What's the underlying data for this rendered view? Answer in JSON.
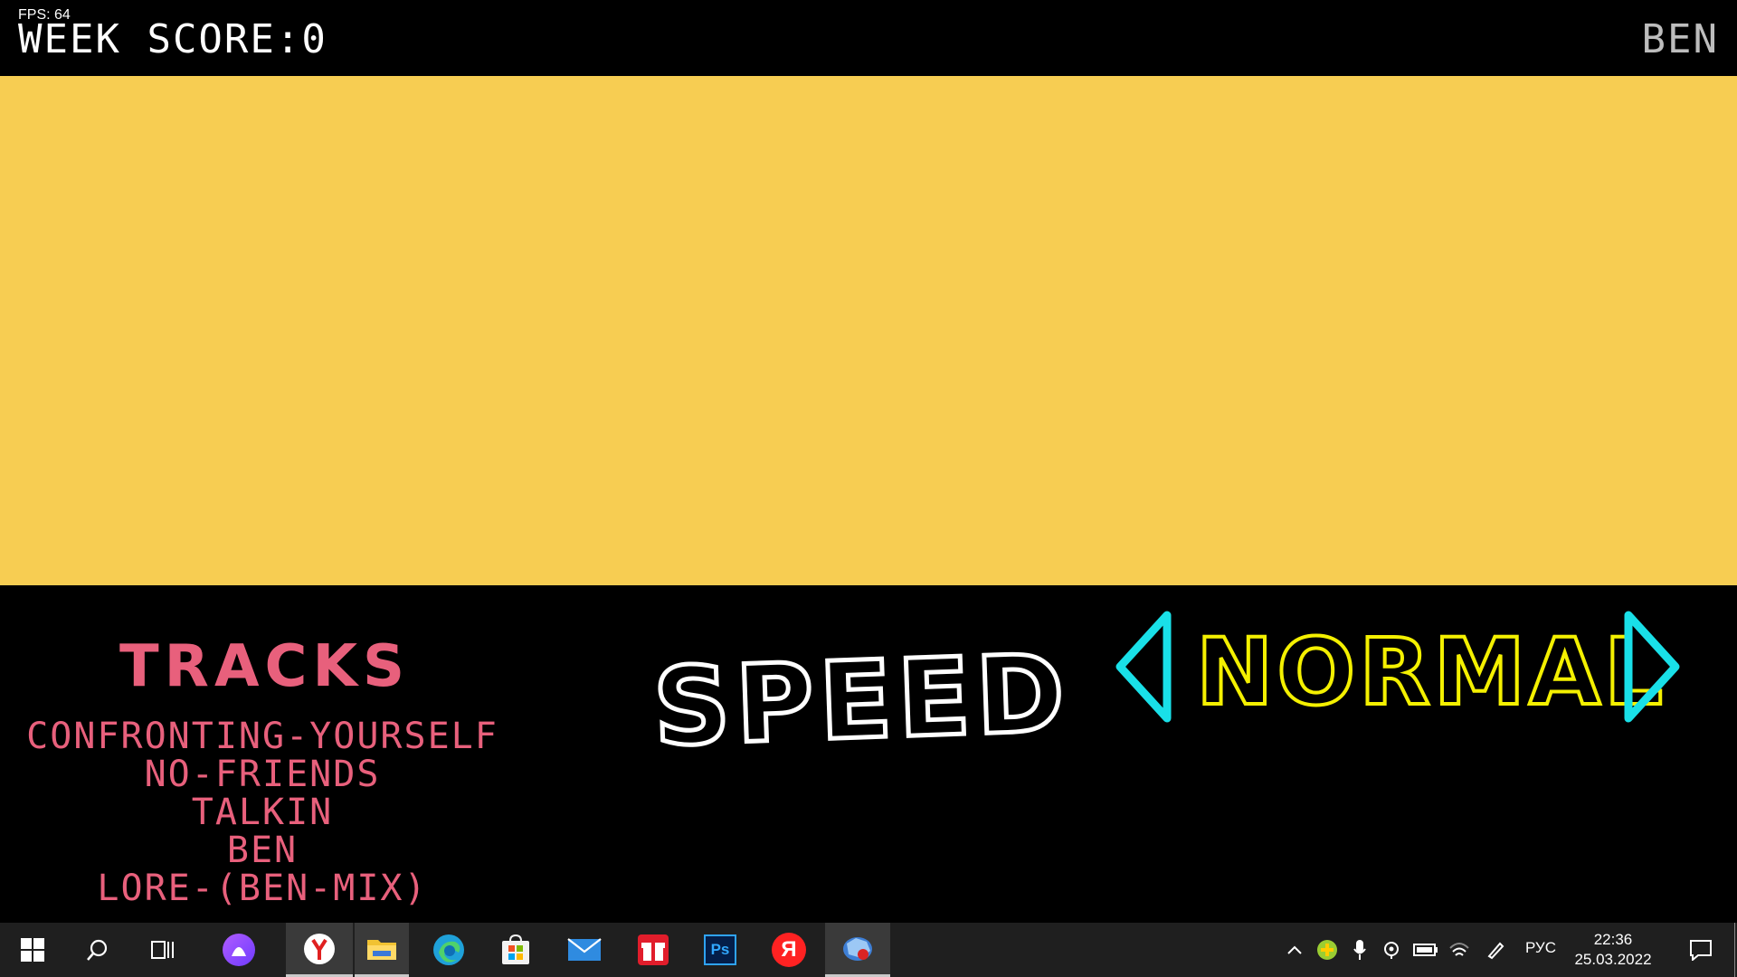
{
  "game": {
    "fps": "FPS: 64",
    "score": "WEEK SCORE:0",
    "week_name": "BEN",
    "banner_color": "#f7cd52",
    "tracks_title": "TRACKS",
    "tracks": [
      "CONFRONTING-YOURSELF",
      "NO-FRIENDS",
      "TALKIN",
      "BEN",
      "LORE-(BEN-MIX)"
    ],
    "speed_label": "SPEED",
    "difficulty": "NORMAL",
    "colors": {
      "tracks": "#e8607c",
      "difficulty": "#f4f000",
      "arrows": "#19e0e8"
    }
  },
  "taskbar": {
    "icons": [
      "windows-start-icon",
      "search-icon",
      "task-view-icon",
      "alice-icon",
      "yandex-browser-icon",
      "file-explorer-icon",
      "edge-icon",
      "store-icon",
      "mail-icon",
      "gift-icon",
      "photoshop-icon",
      "yandex-icon",
      "game-icon"
    ],
    "photoshop_text": "Ps",
    "yandex_text": "Я",
    "language": "РУС",
    "time": "22:36",
    "date": "25.03.2022"
  }
}
